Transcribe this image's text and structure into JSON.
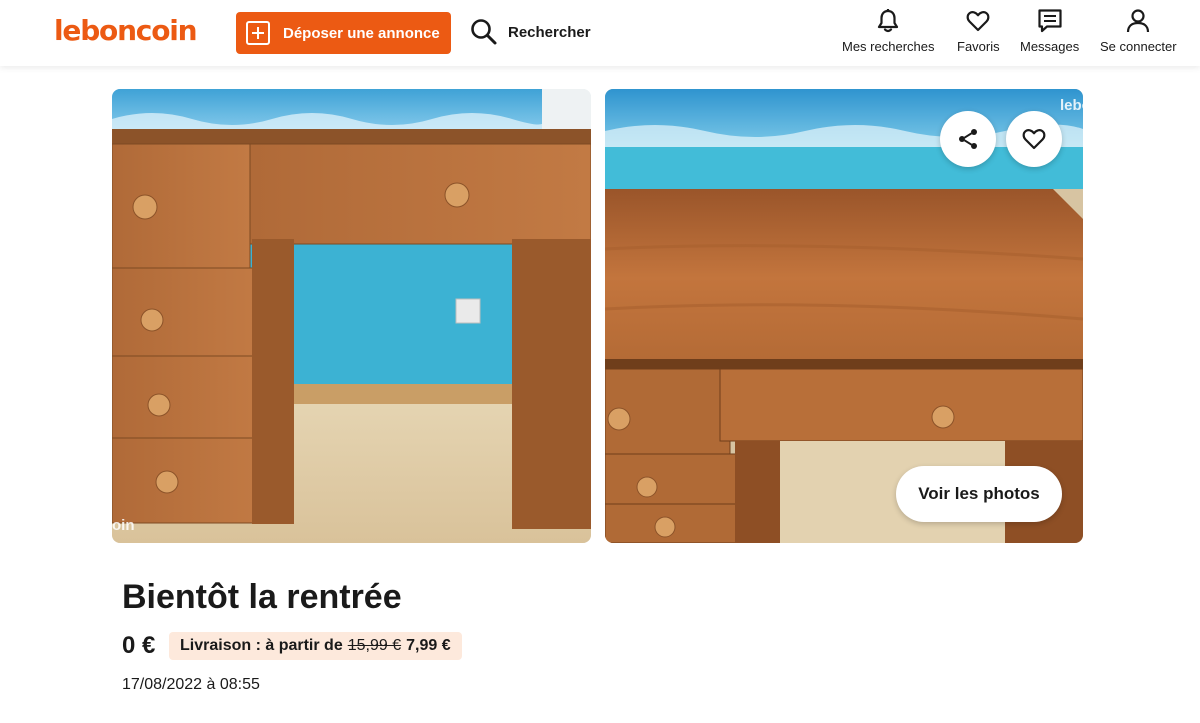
{
  "header": {
    "logo": "leboncoin",
    "deposit_label": "Déposer une annonce",
    "search_label": "Rechercher",
    "nav": [
      {
        "label": "Mes recherches",
        "icon": "bell-icon"
      },
      {
        "label": "Favoris",
        "icon": "heart-icon"
      },
      {
        "label": "Messages",
        "icon": "message-icon"
      },
      {
        "label": "Se connecter",
        "icon": "user-icon"
      }
    ]
  },
  "gallery": {
    "watermark_left": "oin",
    "watermark_right": "lebo",
    "view_photos_label": "Voir les photos"
  },
  "ad": {
    "title": "Bientôt la rentrée",
    "price": "0 €",
    "delivery_prefix": "Livraison : à partir de",
    "delivery_old_price": "15,99 €",
    "delivery_new_price": "7,99 €",
    "date": "17/08/2022 à 08:55"
  },
  "colors": {
    "brand": "#ec5a13",
    "delivery_badge_bg": "#fde9dc"
  }
}
